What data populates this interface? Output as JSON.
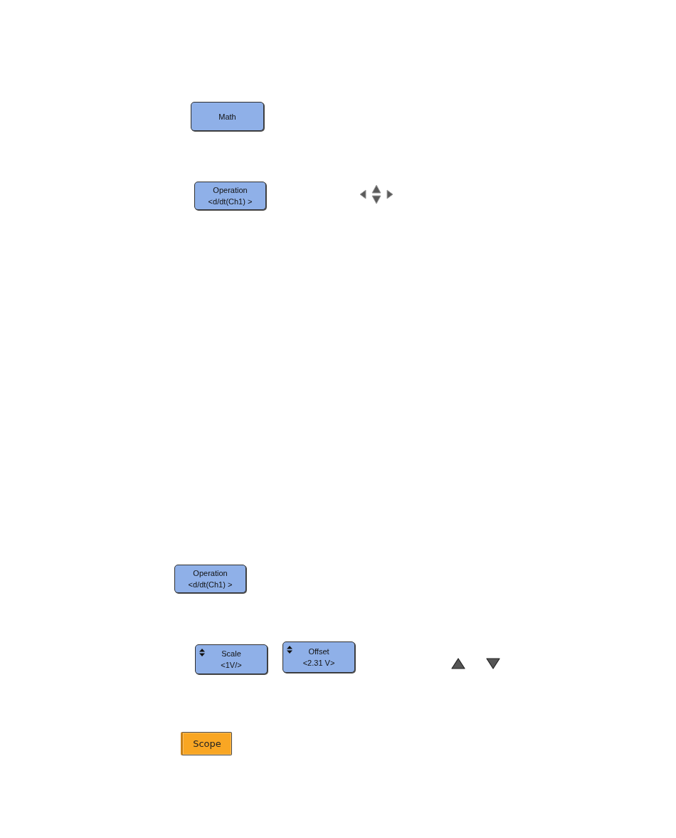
{
  "math_key": {
    "label": "Math"
  },
  "operation_softkey": {
    "title": "Operation",
    "value": "<d/dt(Ch1) >"
  },
  "operation_softkey_repeat": {
    "title": "Operation",
    "value": "<d/dt(Ch1) >"
  },
  "adjust_softkeys": [
    {
      "title": "Scale",
      "value": "<1V/>"
    },
    {
      "title": "Offset",
      "value": "<2.31 V>"
    }
  ],
  "scope_key": {
    "label": "Scope"
  }
}
